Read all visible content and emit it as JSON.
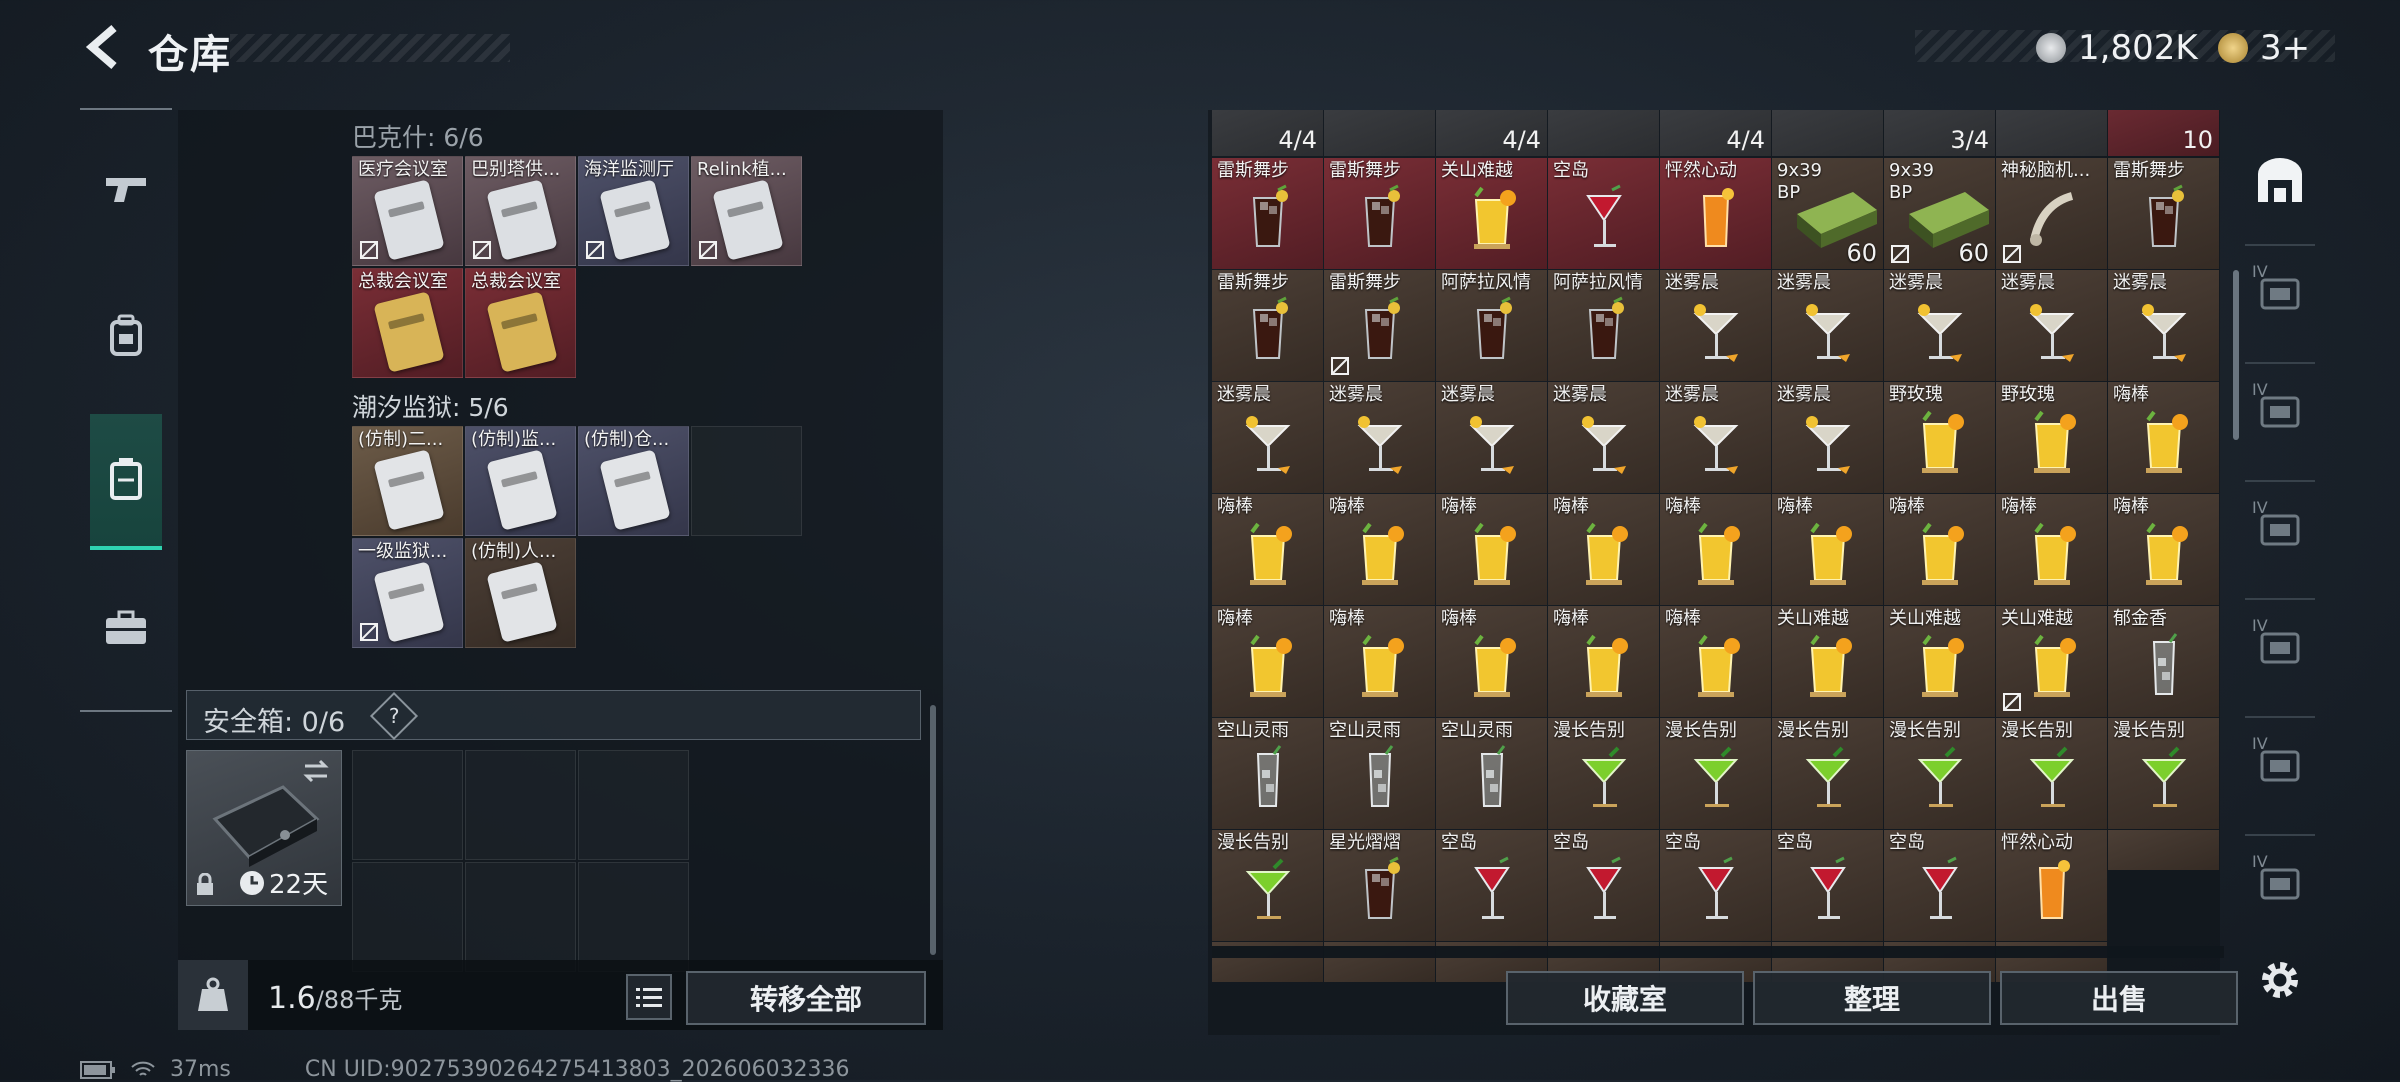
{
  "header": {
    "title": "仓库",
    "currency_silver": "1,802K",
    "currency_gold": "3+"
  },
  "nav": {
    "items": [
      {
        "name": "weapon",
        "icon": "gun-icon"
      },
      {
        "name": "gear",
        "icon": "backpack-icon"
      },
      {
        "name": "storage",
        "icon": "locker-icon",
        "active": true
      },
      {
        "name": "kit",
        "icon": "briefcase-icon"
      }
    ]
  },
  "left": {
    "section1_label": "巴克什: 6/6",
    "section1_items": [
      {
        "name": "医疗会议室",
        "bg": "bg-purple",
        "card": "#dcdfe3",
        "noshare": true
      },
      {
        "name": "巴别塔供...",
        "bg": "bg-purple",
        "card": "#dcdfe3",
        "noshare": true
      },
      {
        "name": "海洋监测厅",
        "bg": "bg-blue",
        "card": "#dcdfe3",
        "noshare": true
      },
      {
        "name": "Relink植...",
        "bg": "bg-purple",
        "card": "#dcdfe3",
        "noshare": true
      },
      {
        "name": "总裁会议室",
        "bg": "bg-red",
        "card": "#d8b457",
        "noshare": false
      },
      {
        "name": "总裁会议室",
        "bg": "bg-red",
        "card": "#d8b457",
        "noshare": false
      }
    ],
    "section2_label": "潮汐监狱: 5/6",
    "section2_items": [
      {
        "name": "(仿制)二...",
        "bg": "bg-gold",
        "card": "#e2e4e7",
        "noshare": false
      },
      {
        "name": "(仿制)监...",
        "bg": "bg-blue",
        "card": "#e2e4e7",
        "noshare": false
      },
      {
        "name": "(仿制)仓...",
        "bg": "bg-blue",
        "card": "#e2e4e7",
        "noshare": false
      },
      {
        "name": "",
        "bg": "empty"
      },
      {
        "name": "一级监狱...",
        "bg": "bg-blue",
        "card": "#e2e4e7",
        "noshare": true
      },
      {
        "name": "(仿制)人...",
        "bg": "bg-brown",
        "card": "#e2e4e7",
        "noshare": false
      }
    ],
    "safe_label": "安全箱: 0/6",
    "safe_help": "?",
    "case_days": "22天",
    "weight_current": "1.6",
    "weight_max": "/88千克",
    "transfer_all": "转移全部"
  },
  "right": {
    "top_counts": [
      "4/4",
      "4/4",
      "4/4",
      "3/4",
      "10"
    ],
    "rows": [
      [
        {
          "name": "雷斯舞步",
          "bg": "bg-red",
          "type": "cola"
        },
        {
          "name": "雷斯舞步",
          "bg": "bg-red",
          "type": "cola"
        },
        {
          "name": "关山难越",
          "bg": "bg-red",
          "type": "yellow"
        },
        {
          "name": "空岛",
          "bg": "bg-red",
          "type": "redwine"
        },
        {
          "name": "怦然心动",
          "bg": "bg-red",
          "type": "orange"
        },
        {
          "name": "9x39 BP",
          "bg": "bg-brown",
          "type": "ammo",
          "count": "60"
        },
        {
          "name": "9x39 BP",
          "bg": "bg-brown",
          "type": "ammo",
          "count": "60",
          "noshare": true
        },
        {
          "name": "神秘脑机...",
          "bg": "bg-brown",
          "type": "device",
          "noshare": true
        },
        {
          "name": "雷斯舞步",
          "bg": "bg-brown",
          "type": "cola"
        }
      ],
      [
        {
          "name": "雷斯舞步",
          "bg": "bg-brown",
          "type": "cola"
        },
        {
          "name": "雷斯舞步",
          "bg": "bg-brown",
          "type": "cola",
          "noshare": true
        },
        {
          "name": "阿萨拉风情",
          "bg": "bg-brown",
          "type": "cola"
        },
        {
          "name": "阿萨拉风情",
          "bg": "bg-brown",
          "type": "cola"
        },
        {
          "name": "迷雾晨",
          "bg": "bg-brown",
          "type": "martini"
        },
        {
          "name": "迷雾晨",
          "bg": "bg-brown",
          "type": "martini"
        },
        {
          "name": "迷雾晨",
          "bg": "bg-brown",
          "type": "martini"
        },
        {
          "name": "迷雾晨",
          "bg": "bg-brown",
          "type": "martini"
        },
        {
          "name": "迷雾晨",
          "bg": "bg-brown",
          "type": "martini"
        }
      ],
      [
        {
          "name": "迷雾晨",
          "bg": "bg-brown",
          "type": "martini"
        },
        {
          "name": "迷雾晨",
          "bg": "bg-brown",
          "type": "martini"
        },
        {
          "name": "迷雾晨",
          "bg": "bg-brown",
          "type": "martini"
        },
        {
          "name": "迷雾晨",
          "bg": "bg-brown",
          "type": "martini"
        },
        {
          "name": "迷雾晨",
          "bg": "bg-brown",
          "type": "martini"
        },
        {
          "name": "迷雾晨",
          "bg": "bg-brown",
          "type": "martini"
        },
        {
          "name": "野玫瑰",
          "bg": "bg-brown",
          "type": "yellow"
        },
        {
          "name": "野玫瑰",
          "bg": "bg-brown",
          "type": "yellow"
        },
        {
          "name": "嗨棒",
          "bg": "bg-brown",
          "type": "yellow"
        }
      ],
      [
        {
          "name": "嗨棒",
          "bg": "bg-brown",
          "type": "yellow"
        },
        {
          "name": "嗨棒",
          "bg": "bg-brown",
          "type": "yellow"
        },
        {
          "name": "嗨棒",
          "bg": "bg-brown",
          "type": "yellow"
        },
        {
          "name": "嗨棒",
          "bg": "bg-brown",
          "type": "yellow"
        },
        {
          "name": "嗨棒",
          "bg": "bg-brown",
          "type": "yellow"
        },
        {
          "name": "嗨棒",
          "bg": "bg-brown",
          "type": "yellow"
        },
        {
          "name": "嗨棒",
          "bg": "bg-brown",
          "type": "yellow"
        },
        {
          "name": "嗨棒",
          "bg": "bg-brown",
          "type": "yellow"
        },
        {
          "name": "嗨棒",
          "bg": "bg-brown",
          "type": "yellow"
        }
      ],
      [
        {
          "name": "嗨棒",
          "bg": "bg-brown",
          "type": "yellow"
        },
        {
          "name": "嗨棒",
          "bg": "bg-brown",
          "type": "yellow"
        },
        {
          "name": "嗨棒",
          "bg": "bg-brown",
          "type": "yellow"
        },
        {
          "name": "嗨棒",
          "bg": "bg-brown",
          "type": "yellow"
        },
        {
          "name": "嗨棒",
          "bg": "bg-brown",
          "type": "yellow"
        },
        {
          "name": "关山难越",
          "bg": "bg-brown",
          "type": "yellow"
        },
        {
          "name": "关山难越",
          "bg": "bg-brown",
          "type": "yellow"
        },
        {
          "name": "关山难越",
          "bg": "bg-brown",
          "type": "yellow",
          "noshare": true
        },
        {
          "name": "郁金香",
          "bg": "bg-brown",
          "type": "clear"
        }
      ],
      [
        {
          "name": "空山灵雨",
          "bg": "bg-brown",
          "type": "clear"
        },
        {
          "name": "空山灵雨",
          "bg": "bg-brown",
          "type": "clear"
        },
        {
          "name": "空山灵雨",
          "bg": "bg-brown",
          "type": "clear"
        },
        {
          "name": "漫长告别",
          "bg": "bg-brown",
          "type": "green"
        },
        {
          "name": "漫长告别",
          "bg": "bg-brown",
          "type": "green"
        },
        {
          "name": "漫长告别",
          "bg": "bg-brown",
          "type": "green"
        },
        {
          "name": "漫长告别",
          "bg": "bg-brown",
          "type": "green"
        },
        {
          "name": "漫长告别",
          "bg": "bg-brown",
          "type": "green"
        },
        {
          "name": "漫长告别",
          "bg": "bg-brown",
          "type": "green"
        }
      ],
      [
        {
          "name": "漫长告别",
          "bg": "bg-brown",
          "type": "green"
        },
        {
          "name": "星光熠熠",
          "bg": "bg-brown",
          "type": "cola"
        },
        {
          "name": "空岛",
          "bg": "bg-brown",
          "type": "redwine"
        },
        {
          "name": "空岛",
          "bg": "bg-brown",
          "type": "redwine"
        },
        {
          "name": "空岛",
          "bg": "bg-brown",
          "type": "redwine"
        },
        {
          "name": "空岛",
          "bg": "bg-brown",
          "type": "redwine"
        },
        {
          "name": "空岛",
          "bg": "bg-brown",
          "type": "redwine"
        },
        {
          "name": "怦然心动",
          "bg": "bg-brown",
          "type": "orange"
        }
      ]
    ],
    "collection_btn": "收藏室",
    "organize_btn": "整理",
    "sell_btn": "出售"
  },
  "sidebar_right": {
    "tiers": [
      "IV",
      "IV",
      "IV",
      "IV",
      "IV",
      "IV"
    ]
  },
  "footer": {
    "ping": "37ms",
    "uid": "CN UID:9027539026427541380​3_202606032336"
  }
}
